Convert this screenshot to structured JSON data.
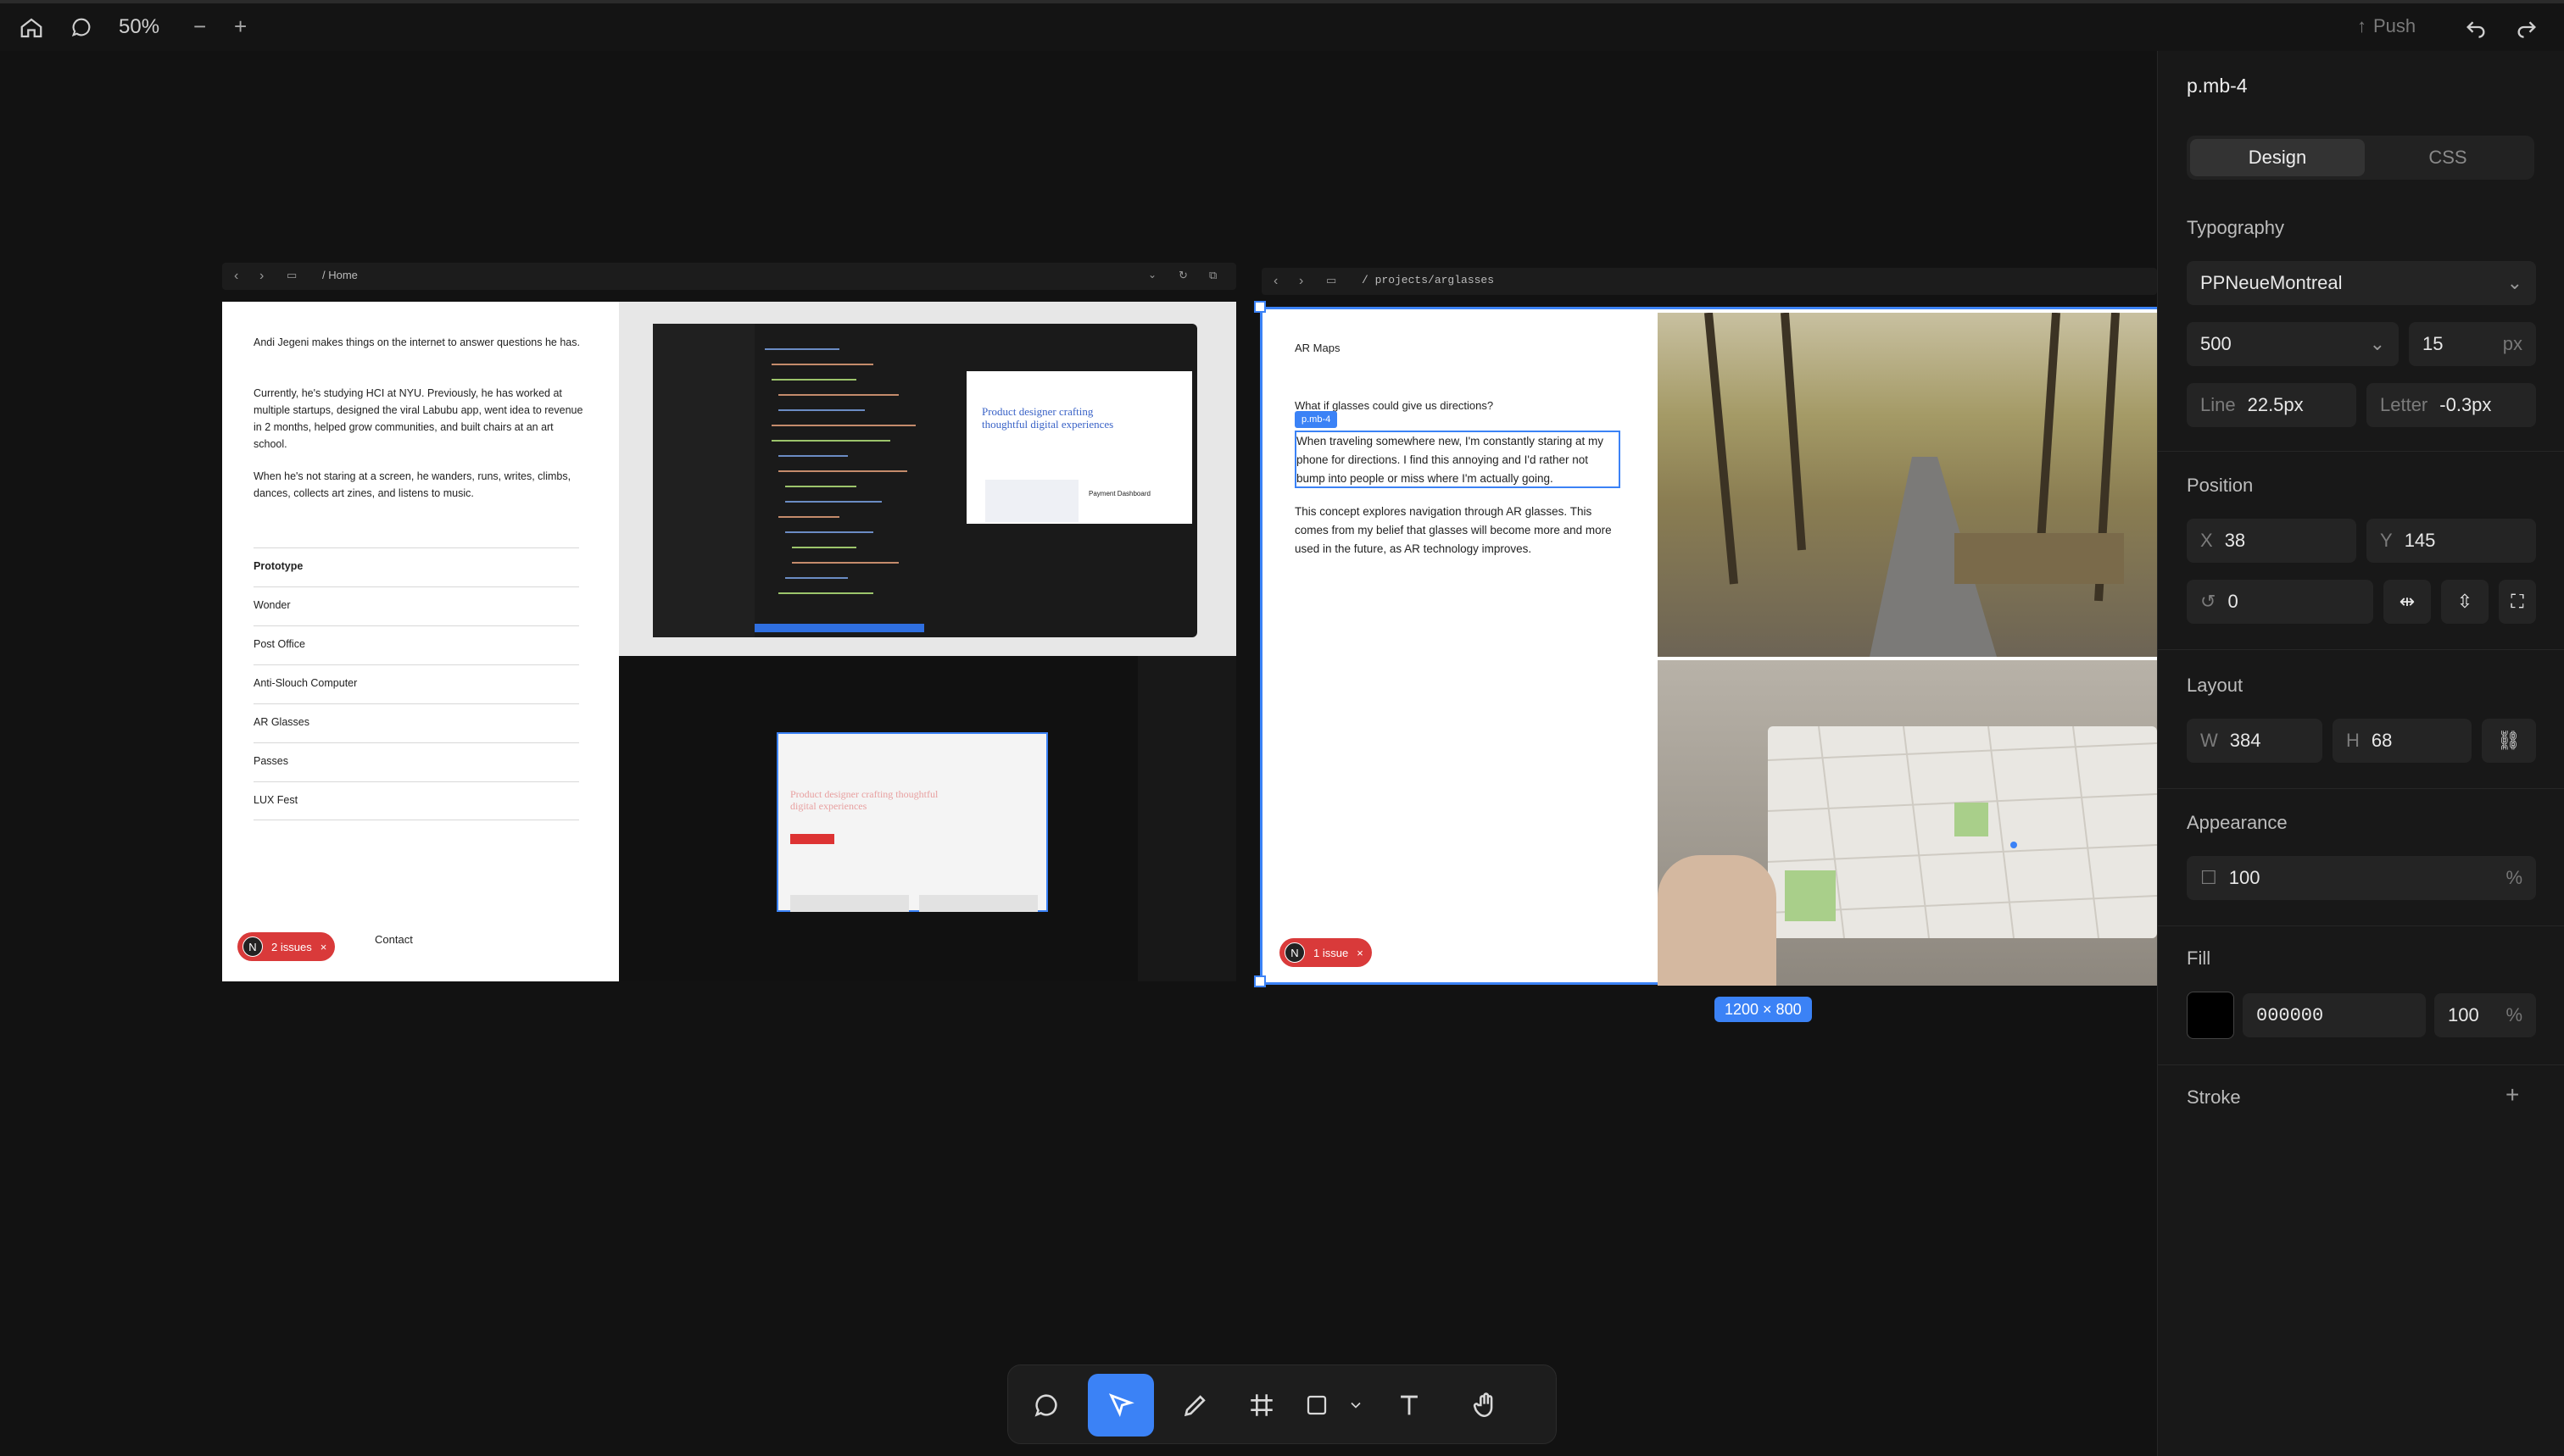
{
  "toolbar": {
    "zoom": "50%",
    "zoom_out": "−",
    "zoom_in": "+",
    "push_label": "Push"
  },
  "left_frame": {
    "url": "/ Home",
    "bio": [
      "Andi Jegeni makes things on the internet to answer questions he has.",
      "Currently, he's studying HCI at NYU. Previously, he has worked at multiple startups, designed the viral Labubu app, went idea to revenue in 2 months, helped grow communities, and built chairs at an art school.",
      "When he's not staring at a screen, he wanders, runs, writes, climbs, dances, collects art zines, and listens to music."
    ],
    "projects": [
      "Prototype",
      "Wonder",
      "Post Office",
      "Anti-Slouch Computer",
      "AR Glasses",
      "Passes",
      "LUX Fest"
    ],
    "issues_label": "2 issues",
    "contact_label": "Contact",
    "inner_headline": "Product designer crafting thoughtful digital experiences",
    "inner_card": "Payment Dashboard"
  },
  "right_frame": {
    "url": "/ projects/arglasses",
    "title": "AR Maps",
    "question": "What if glasses could give us directions?",
    "selected_tag": "p.mb-4",
    "selected_text": "When traveling somewhere new, I'm constantly staring at my phone for directions. I find this annoying and I'd rather not bump into people or miss where I'm actually going.",
    "body": "This concept explores navigation through AR glasses. This comes from my belief that glasses will become more and more used in the future, as AR technology improves.",
    "issues_label": "1 issue",
    "size_badge": "1200 × 800"
  },
  "panel": {
    "element": "p.mb-4",
    "tab_design": "Design",
    "tab_css": "CSS",
    "typography": {
      "title": "Typography",
      "font": "PPNeueMontreal",
      "weight": "500",
      "size": "15",
      "size_unit": "px",
      "line_label": "Line",
      "line": "22.5px",
      "letter_label": "Letter",
      "letter": "-0.3px"
    },
    "position": {
      "title": "Position",
      "x_label": "X",
      "x": "38",
      "y_label": "Y",
      "y": "145",
      "rotation": "0"
    },
    "layout": {
      "title": "Layout",
      "w_label": "W",
      "w": "384",
      "h_label": "H",
      "h": "68"
    },
    "appearance": {
      "title": "Appearance",
      "opacity": "100",
      "unit": "%"
    },
    "fill": {
      "title": "Fill",
      "hex": "000000",
      "opacity": "100",
      "unit": "%",
      "color": "#000000"
    },
    "stroke": {
      "title": "Stroke"
    }
  },
  "colors": {
    "accent": "#3b82f6",
    "issue": "#d93a3a"
  },
  "icons": [
    "home-icon",
    "comment-icon",
    "undo-icon",
    "redo-icon",
    "select-icon",
    "pen-icon",
    "frame-icon",
    "rectangle-icon",
    "text-icon",
    "hand-icon"
  ]
}
